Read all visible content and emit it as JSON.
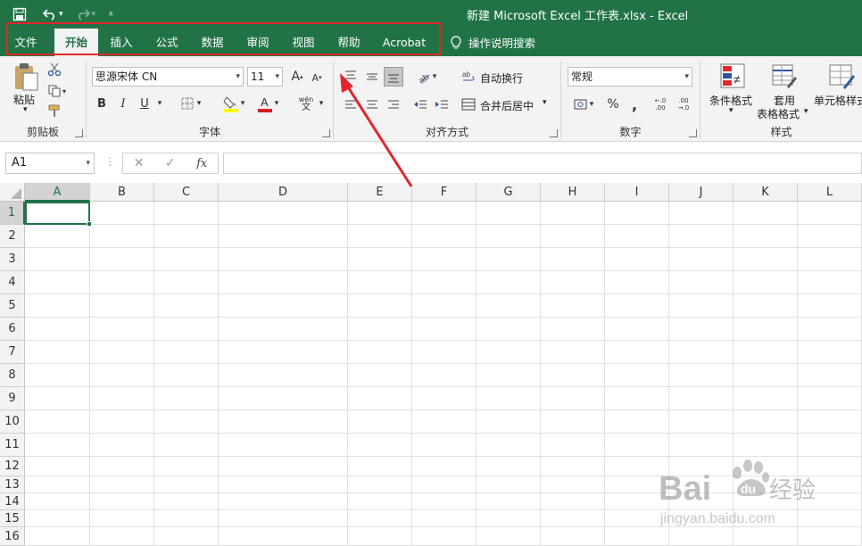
{
  "window": {
    "title": "新建 Microsoft Excel 工作表.xlsx  -  Excel"
  },
  "tabs": [
    {
      "label": "文件"
    },
    {
      "label": "开始",
      "active": true
    },
    {
      "label": "插入"
    },
    {
      "label": "公式"
    },
    {
      "label": "数据"
    },
    {
      "label": "审阅"
    },
    {
      "label": "视图"
    },
    {
      "label": "帮助"
    },
    {
      "label": "Acrobat"
    }
  ],
  "tell_me": "操作说明搜索",
  "clipboard": {
    "paste": "粘贴",
    "group": "剪贴板"
  },
  "font": {
    "name": "思源宋体 CN",
    "size": "11",
    "bold": "B",
    "italic": "I",
    "underline": "U",
    "group": "字体",
    "grow": "A",
    "shrink": "A",
    "phonetic_top": "wén",
    "phonetic_bottom": "文"
  },
  "alignment": {
    "wrap": "自动换行",
    "merge": "合并后居中",
    "group": "对齐方式"
  },
  "number": {
    "format": "常规",
    "percent": "%",
    "comma": ",",
    "dec_inc": "←.0 .00",
    "dec_dec": ".00 →.0",
    "group": "数字"
  },
  "styles": {
    "conditional": "条件格式",
    "table_top": "套用",
    "table_bottom": "表格格式",
    "cell": "单元格样式",
    "group": "样式"
  },
  "formula_bar": {
    "name_box": "A1",
    "fx": "fx",
    "cancel": "✕",
    "enter": "✓"
  },
  "columns": [
    "A",
    "B",
    "C",
    "D",
    "E",
    "F",
    "G",
    "H",
    "I",
    "J",
    "K",
    "L"
  ],
  "rows": [
    "1",
    "2",
    "3",
    "4",
    "5",
    "6",
    "7",
    "8",
    "9",
    "10",
    "11",
    "12",
    "13",
    "14",
    "15",
    "16"
  ],
  "watermark": {
    "brand": "Bai",
    "brand2": "du",
    "suffix": "经验",
    "url": "jingyan.baidu.com"
  },
  "colors": {
    "excel_green": "#217346",
    "highlight_red": "#e0262c",
    "ribbon_bg": "#f3f3f3"
  }
}
